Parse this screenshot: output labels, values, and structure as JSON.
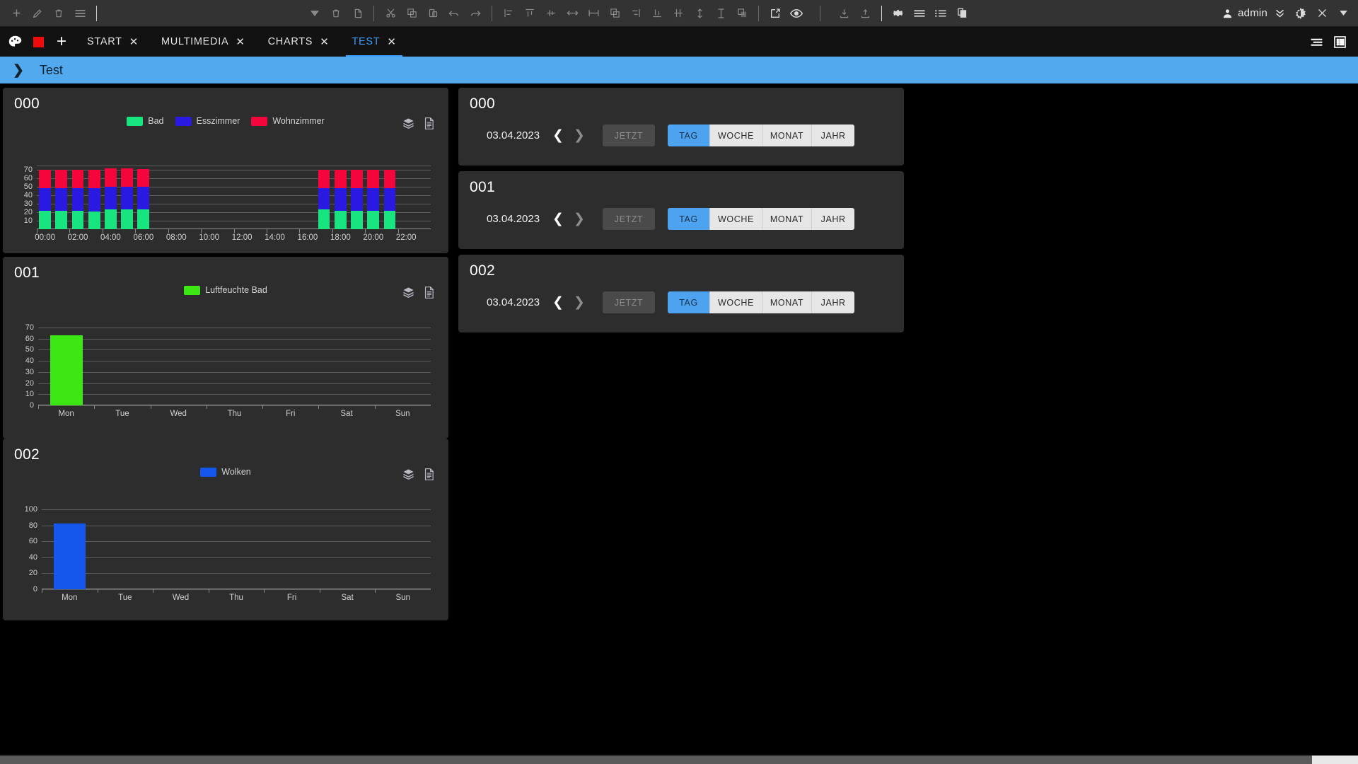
{
  "toolbar": {
    "left_icons": [
      {
        "name": "add-icon",
        "glyph": "plus"
      },
      {
        "name": "edit-pencil-icon",
        "glyph": "pencil"
      },
      {
        "name": "delete-trash-icon",
        "glyph": "trash"
      },
      {
        "name": "menu-hamburger-icon",
        "glyph": "hamburger"
      }
    ],
    "mid_icons": [
      {
        "name": "dropdown-caret-icon",
        "glyph": "caret-down"
      },
      {
        "name": "delete-widget-icon",
        "glyph": "trash"
      },
      {
        "name": "duplicate-widget-icon",
        "glyph": "copy"
      }
    ],
    "edit_icons": [
      {
        "name": "cut-icon",
        "glyph": "scissors"
      },
      {
        "name": "copy-icon",
        "glyph": "copy-square"
      },
      {
        "name": "paste-icon",
        "glyph": "paste"
      },
      {
        "name": "undo-icon",
        "glyph": "undo"
      },
      {
        "name": "redo-icon",
        "glyph": "redo"
      }
    ],
    "align_icons": [
      {
        "name": "align-left-icon",
        "glyph": "align-left"
      },
      {
        "name": "align-top-icon",
        "glyph": "align-top"
      },
      {
        "name": "align-vertical-center-icon",
        "glyph": "align-vcenter"
      },
      {
        "name": "distribute-horizontal-icon",
        "glyph": "dist-h"
      },
      {
        "name": "align-horizontal-center-icon",
        "glyph": "align-hcenter"
      },
      {
        "name": "bring-forward-icon",
        "glyph": "forward"
      },
      {
        "name": "align-right-icon",
        "glyph": "align-right"
      },
      {
        "name": "align-bottom-icon",
        "glyph": "align-bottom"
      },
      {
        "name": "distribute-vertical-icon",
        "glyph": "dist-v"
      },
      {
        "name": "equal-height-icon",
        "glyph": "eq-height"
      },
      {
        "name": "equal-width-icon",
        "glyph": "eq-width"
      },
      {
        "name": "send-backward-icon",
        "glyph": "backward"
      }
    ],
    "view_icons": [
      {
        "name": "open-external-icon",
        "glyph": "external"
      },
      {
        "name": "preview-eye-icon",
        "glyph": "eye"
      }
    ],
    "io_icons": [
      {
        "name": "import-icon",
        "glyph": "import"
      },
      {
        "name": "export-icon",
        "glyph": "export"
      }
    ],
    "settings_icons": [
      {
        "name": "settings-gear-icon",
        "glyph": "gear"
      },
      {
        "name": "list-lines-icon",
        "glyph": "lines"
      },
      {
        "name": "list-bullets-icon",
        "glyph": "bullets"
      },
      {
        "name": "copy-pages-icon",
        "glyph": "pages"
      }
    ],
    "user": {
      "name": "admin",
      "account_icon": "user-icon",
      "expand_icon": "double-chevron-down-icon",
      "theme_icon": "brightness-toggle-icon",
      "close_icon": "close-icon",
      "more_icon": "caret-down-icon"
    }
  },
  "tabbar": {
    "palette_icon": "palette-icon",
    "color_swatch": "#f00b0b",
    "add_tab_label": "+",
    "tabs": [
      {
        "label": "START",
        "active": false
      },
      {
        "label": "MULTIMEDIA",
        "active": false
      },
      {
        "label": "CHARTS",
        "active": false
      },
      {
        "label": "TEST",
        "active": true
      }
    ],
    "right_icons": [
      {
        "name": "align-lines-icon",
        "glyph": "align-lines"
      },
      {
        "name": "grid-panel-icon",
        "glyph": "grid-panel"
      }
    ],
    "active_color": "#3b9dff"
  },
  "breadcrumb": {
    "expand_icon": "chevron-right-icon",
    "title": "Test",
    "background": "#52a9ee"
  },
  "cards": [
    {
      "title": "000",
      "type": "chart"
    },
    {
      "title": "001",
      "type": "chart"
    },
    {
      "title": "002",
      "type": "chart"
    },
    {
      "title": "000",
      "type": "control"
    },
    {
      "title": "001",
      "type": "control"
    },
    {
      "title": "002",
      "type": "control"
    }
  ],
  "chart_icons": {
    "layers": "layers-icon",
    "document": "document-icon"
  },
  "controls": {
    "date": "03.04.2023",
    "prev_icon": "chevron-left-icon",
    "next_icon": "chevron-right-icon",
    "now_label": "JETZT",
    "ranges": [
      {
        "label": "TAG",
        "active": true
      },
      {
        "label": "WOCHE",
        "active": false
      },
      {
        "label": "MONAT",
        "active": false
      },
      {
        "label": "JAHR",
        "active": false
      }
    ],
    "active_color": "#4da3f0"
  },
  "chart_data": [
    {
      "id": "000",
      "type": "bar",
      "stacked": true,
      "title": "000",
      "xlabel": "",
      "ylabel": "",
      "ylim": [
        0,
        75
      ],
      "yticks": [
        10,
        20,
        30,
        40,
        50,
        60,
        70
      ],
      "grid": true,
      "legend_position": "top-center",
      "xtick_labels": [
        "00:00",
        "02:00",
        "04:00",
        "06:00",
        "08:00",
        "10:00",
        "12:00",
        "14:00",
        "16:00",
        "18:00",
        "20:00",
        "22:00"
      ],
      "x": [
        "00:00",
        "01:00",
        "02:00",
        "03:00",
        "04:00",
        "05:00",
        "06:00",
        "07:00",
        "08:00",
        "09:00",
        "10:00",
        "11:00",
        "12:00",
        "13:00",
        "14:00",
        "15:00",
        "16:00",
        "17:00",
        "18:00",
        "19:00",
        "20:00",
        "21:00",
        "22:00",
        "23:00"
      ],
      "series": [
        {
          "name": "Bad",
          "color": "#18e57f",
          "values": [
            22,
            22,
            22,
            21,
            23,
            23,
            23,
            0,
            0,
            0,
            0,
            0,
            0,
            0,
            0,
            0,
            0,
            23,
            22,
            22,
            22,
            22,
            0,
            0
          ]
        },
        {
          "name": "Esszimmer",
          "color": "#2a19e0",
          "values": [
            26,
            26,
            26,
            27,
            27,
            27,
            27,
            0,
            0,
            0,
            0,
            0,
            0,
            0,
            0,
            0,
            0,
            25,
            26,
            26,
            26,
            26,
            0,
            0
          ]
        },
        {
          "name": "Wohnzimmer",
          "color": "#f4063c",
          "values": [
            22,
            22,
            22,
            22,
            22,
            22,
            21,
            0,
            0,
            0,
            0,
            0,
            0,
            0,
            0,
            0,
            0,
            22,
            22,
            22,
            22,
            22,
            0,
            0
          ]
        }
      ]
    },
    {
      "id": "001",
      "type": "bar",
      "stacked": false,
      "title": "001",
      "xlabel": "",
      "ylabel": "",
      "ylim": [
        0,
        70
      ],
      "yticks": [
        0,
        10,
        20,
        30,
        40,
        50,
        60,
        70
      ],
      "grid": true,
      "legend_position": "top-center",
      "categories": [
        "Mon",
        "Tue",
        "Wed",
        "Thu",
        "Fri",
        "Sat",
        "Sun"
      ],
      "series": [
        {
          "name": "Luftfeuchte Bad",
          "color": "#3ce612",
          "values": [
            63,
            0,
            0,
            0,
            0,
            0,
            0
          ]
        }
      ]
    },
    {
      "id": "002",
      "type": "bar",
      "stacked": false,
      "title": "002",
      "xlabel": "",
      "ylabel": "",
      "ylim": [
        0,
        100
      ],
      "yticks": [
        0,
        20,
        40,
        60,
        80,
        100
      ],
      "grid": true,
      "legend_position": "top-center",
      "categories": [
        "Mon",
        "Tue",
        "Wed",
        "Thu",
        "Fri",
        "Sat",
        "Sun"
      ],
      "series": [
        {
          "name": "Wolken",
          "color": "#1557ec",
          "values": [
            82,
            0,
            0,
            0,
            0,
            0,
            0
          ]
        }
      ]
    }
  ]
}
